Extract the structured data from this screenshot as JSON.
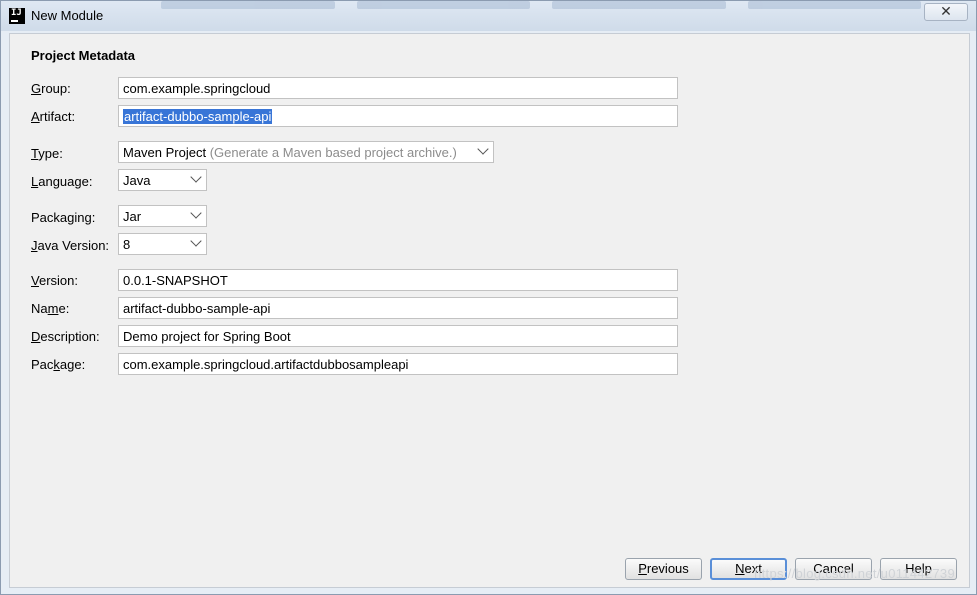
{
  "window": {
    "title": "New Module",
    "close_glyph": "✕"
  },
  "form": {
    "section_title": "Project Metadata",
    "group": {
      "label_pre": "",
      "label_mn": "G",
      "label_post": "roup:",
      "value": "com.example.springcloud"
    },
    "artifact": {
      "label_pre": "",
      "label_mn": "A",
      "label_post": "rtifact:",
      "value": "artifact-dubbo-sample-api"
    },
    "type": {
      "label_pre": "",
      "label_mn": "T",
      "label_post": "ype:",
      "value": "Maven Project",
      "hint": "(Generate a Maven based project archive.)"
    },
    "language": {
      "label_pre": "",
      "label_mn": "L",
      "label_post": "anguage:",
      "value": "Java"
    },
    "packaging": {
      "label_pre": "Packa",
      "label_mn": "g",
      "label_post": "ing:",
      "value": "Jar"
    },
    "java_version": {
      "label_pre": "",
      "label_mn": "J",
      "label_post": "ava Version:",
      "value": "8"
    },
    "version": {
      "label_pre": "",
      "label_mn": "V",
      "label_post": "ersion:",
      "value": "0.0.1-SNAPSHOT"
    },
    "name": {
      "label_pre": "Na",
      "label_mn": "m",
      "label_post": "e:",
      "value": "artifact-dubbo-sample-api"
    },
    "description": {
      "label_pre": "",
      "label_mn": "D",
      "label_post": "escription:",
      "value": "Demo project for Spring Boot"
    },
    "package": {
      "label_pre": "Pac",
      "label_mn": "k",
      "label_post": "age:",
      "value": "com.example.springcloud.artifactdubbosampleapi"
    }
  },
  "buttons": {
    "previous": {
      "pre": "",
      "mn": "P",
      "post": "revious"
    },
    "next": {
      "pre": "",
      "mn": "N",
      "post": "ext"
    },
    "cancel": "Cancel",
    "help": "Help"
  },
  "watermark": "https://blog.csdn.net/u011442739"
}
